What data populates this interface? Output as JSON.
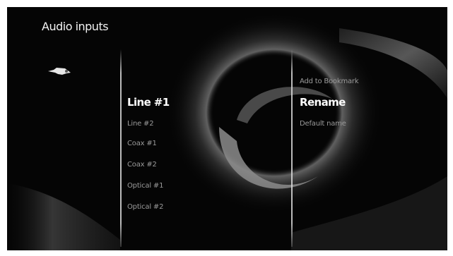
{
  "screen": {
    "title": "Audio inputs"
  },
  "source_icon": "audio-cable-icon",
  "inputs": [
    {
      "label": "Line #1",
      "selected": true
    },
    {
      "label": "Line #2",
      "selected": false
    },
    {
      "label": "Coax #1",
      "selected": false
    },
    {
      "label": "Coax #2",
      "selected": false
    },
    {
      "label": "Optical #1",
      "selected": false
    },
    {
      "label": "Optical #2",
      "selected": false
    }
  ],
  "options_menu": [
    {
      "label": "Add to Bookmark",
      "selected": false
    },
    {
      "label": "Rename",
      "selected": true
    },
    {
      "label": "Default name",
      "selected": false
    }
  ],
  "colors": {
    "background": "#050505",
    "selected_text": "#ffffff",
    "unselected_text": "#9a9a9a"
  }
}
